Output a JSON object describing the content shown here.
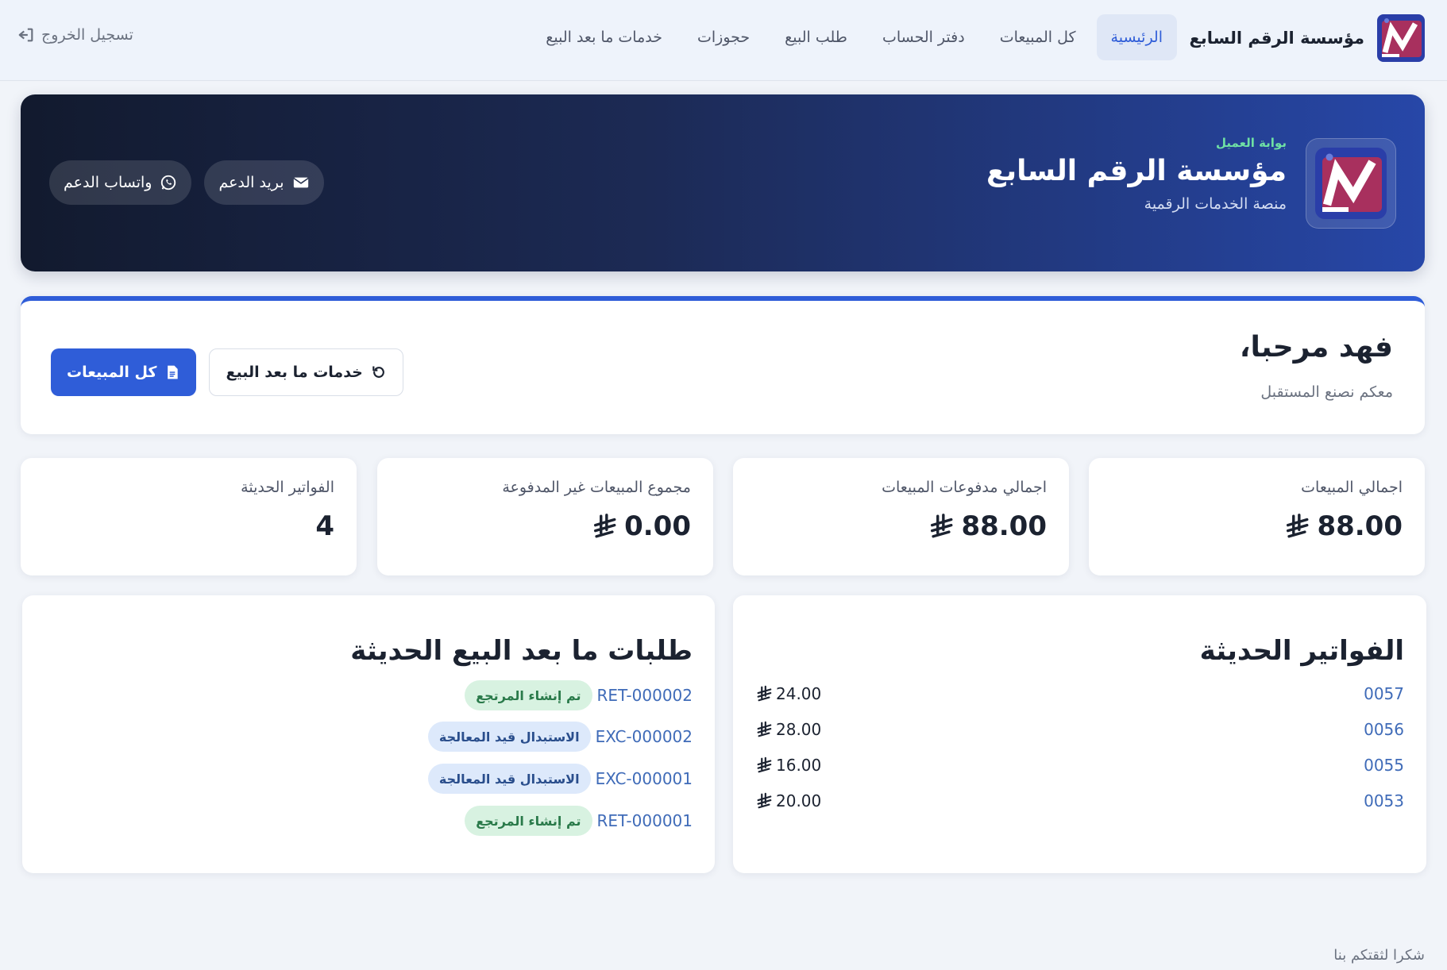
{
  "brand": {
    "name": "مؤسسة الرقم السابع"
  },
  "nav": {
    "items": [
      {
        "label": "الرئيسية"
      },
      {
        "label": "كل المبيعات"
      },
      {
        "label": "دفتر الحساب"
      },
      {
        "label": "طلب البيع"
      },
      {
        "label": "حجوزات"
      },
      {
        "label": "خدمات ما بعد البيع"
      }
    ],
    "logout_label": "تسجيل الخروج"
  },
  "hero": {
    "eyebrow": "بوابة العميل",
    "title": "مؤسسة الرقم السابع",
    "subtitle": "منصة الخدمات الرقمية",
    "whatsapp_label": "واتساب الدعم",
    "email_label": "بريد الدعم"
  },
  "welcome": {
    "title": "فهد مرحبا،",
    "subtitle": "معكم نصنع المستقبل",
    "all_sales_label": "كل المبيعات",
    "after_sales_label": "خدمات ما بعد البيع"
  },
  "stats": [
    {
      "label": "اجمالي المبيعات",
      "value": "88.00",
      "currency": true
    },
    {
      "label": "اجمالي مدفوعات المبيعات",
      "value": "88.00",
      "currency": true
    },
    {
      "label": "مجموع المبيعات غير المدفوعة",
      "value": "0.00",
      "currency": true
    },
    {
      "label": "الفواتير الحديثة",
      "value": "4",
      "currency": false
    }
  ],
  "invoices": {
    "title": "الفواتير الحديثة",
    "rows": [
      {
        "number": "0057",
        "amount": "24.00"
      },
      {
        "number": "0056",
        "amount": "28.00"
      },
      {
        "number": "0055",
        "amount": "16.00"
      },
      {
        "number": "0053",
        "amount": "20.00"
      }
    ]
  },
  "returns": {
    "title": "طلبات ما بعد البيع الحديثة",
    "rows": [
      {
        "code": "RET-000002",
        "status": "تم إنشاء المرتجع",
        "tone": "green"
      },
      {
        "code": "EXC-000002",
        "status": "الاستبدال قيد المعالجة",
        "tone": "blue"
      },
      {
        "code": "EXC-000001",
        "status": "الاستبدال قيد المعالجة",
        "tone": "blue"
      },
      {
        "code": "RET-000001",
        "status": "تم إنشاء المرتجع",
        "tone": "green"
      }
    ]
  },
  "footer": {
    "note": "شكرا لثقتكم بنا"
  },
  "colors": {
    "primary": "#2f5dd8",
    "hero_start": "#121a2e",
    "hero_end": "#2747a8",
    "success": "#6fe0a4"
  }
}
